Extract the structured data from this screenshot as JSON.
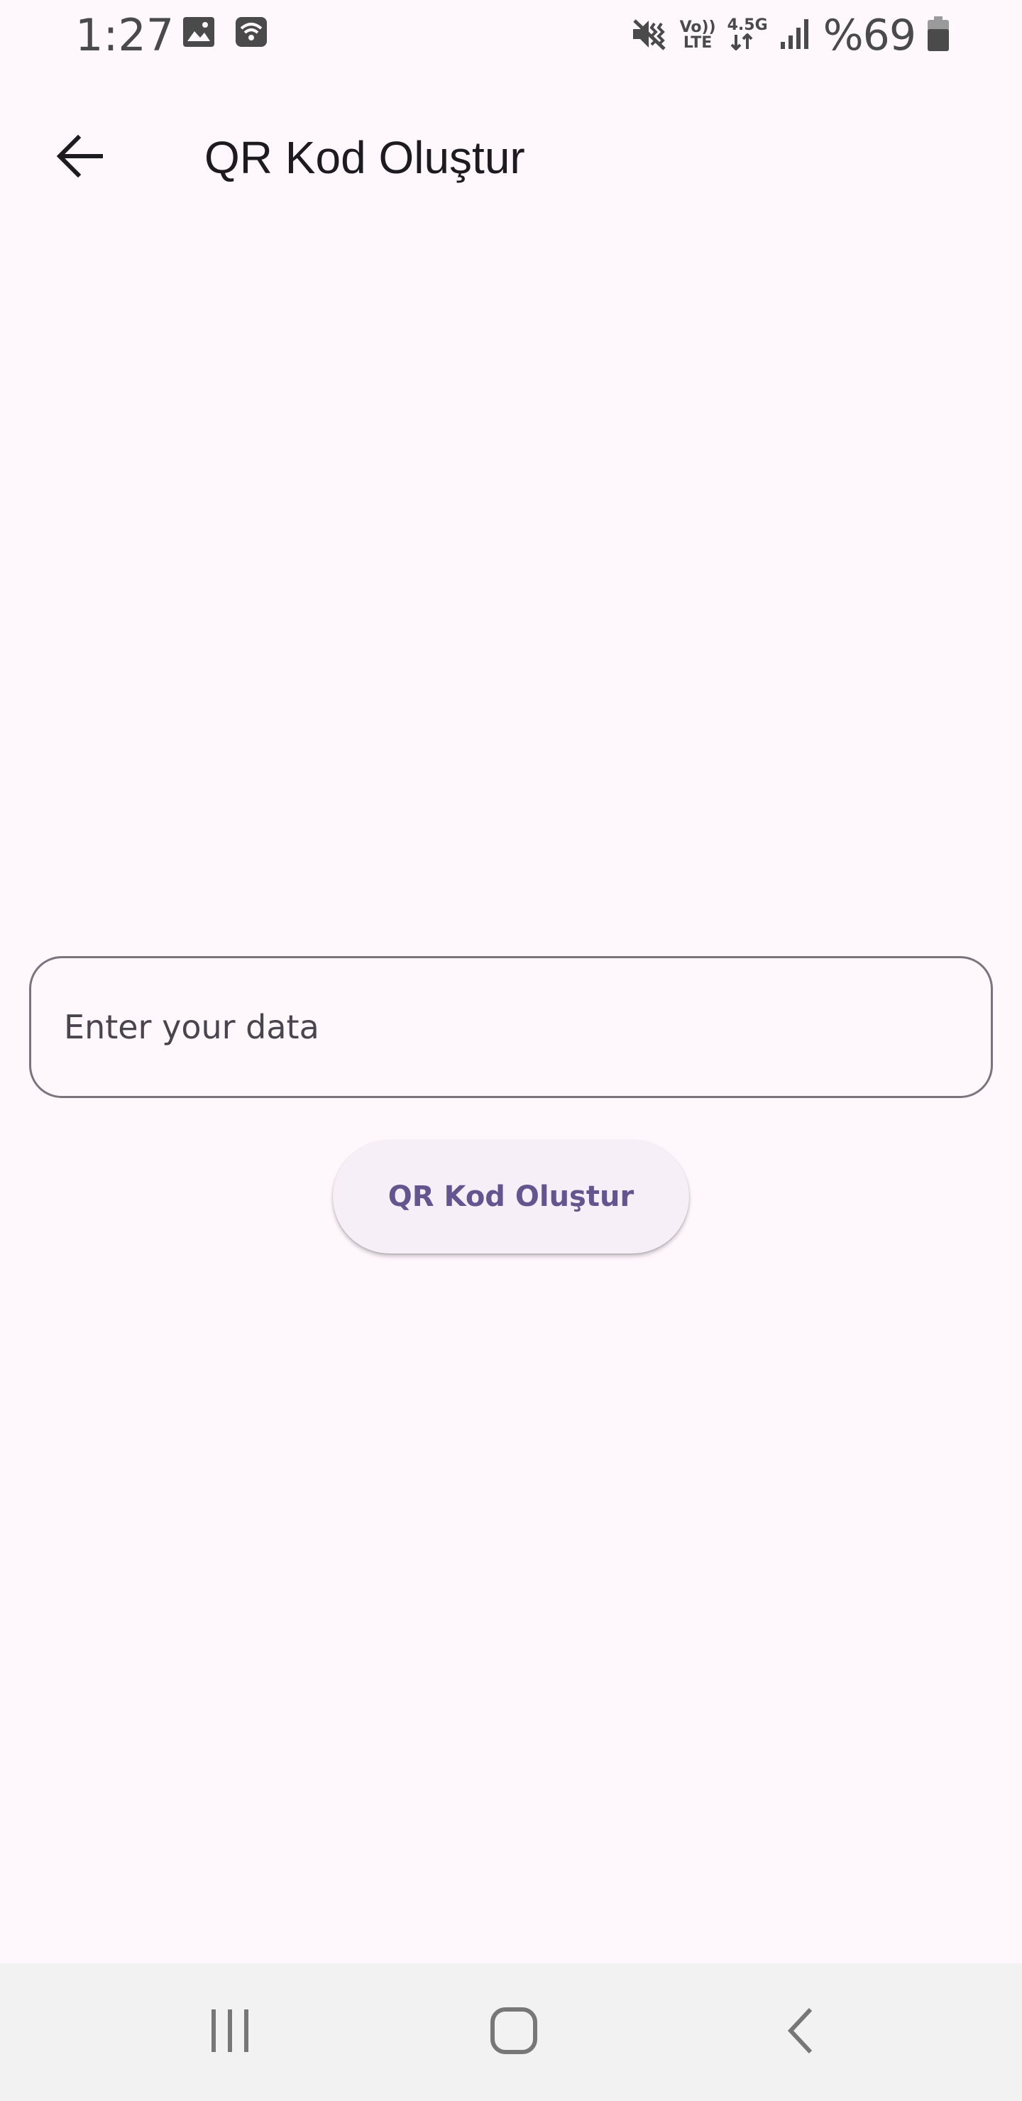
{
  "status_bar": {
    "time": "1:27",
    "volte_top": "Vo))",
    "volte_bottom": "LTE",
    "network": "4.5G",
    "battery": "%69",
    "icons": [
      "gallery-icon",
      "wifi-icon",
      "mute-vibrate-icon",
      "data-arrows-icon",
      "signal-icon",
      "battery-icon"
    ]
  },
  "app_bar": {
    "title": "QR Kod Oluştur",
    "back_icon": "arrow-left-icon"
  },
  "form": {
    "input_placeholder": "Enter your data",
    "input_value": "",
    "button_label": "QR Kod Oluştur"
  },
  "nav_bar": {
    "icons": [
      "recent-apps-icon",
      "home-icon",
      "back-chevron-icon"
    ]
  },
  "colors": {
    "background": "#fef7fc",
    "accent": "#65558f",
    "button_bg": "#f6eff7",
    "outline": "#79747e",
    "nav_bar_bg": "#f2f2f2"
  }
}
